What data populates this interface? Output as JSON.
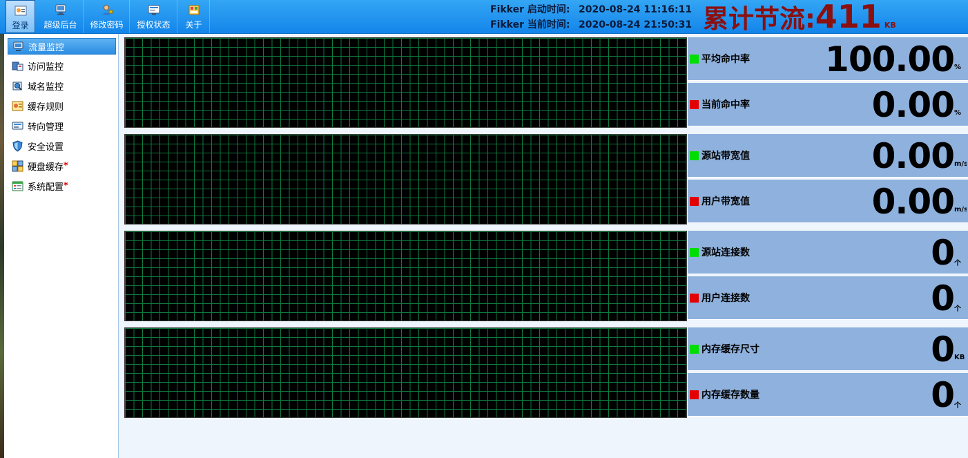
{
  "toolbar": {
    "buttons": [
      {
        "label": "登录",
        "icon": "login-icon"
      },
      {
        "label": "超级后台",
        "icon": "monitor-icon"
      },
      {
        "label": "修改密码",
        "icon": "user-key-icon"
      },
      {
        "label": "授权状态",
        "icon": "license-icon"
      },
      {
        "label": "关于",
        "icon": "about-icon"
      }
    ]
  },
  "times": {
    "start_label": "Fikker 启动时间:",
    "start_value": "2020-08-24 11:16:11",
    "now_label": "Fikker 当前时间:",
    "now_value": "2020-08-24 21:50:31"
  },
  "total": {
    "label": "累计节流:",
    "value": "411",
    "unit": "KB"
  },
  "sidebar": {
    "items": [
      {
        "label": "流量监控",
        "icon": "traffic-monitor-icon"
      },
      {
        "label": "访问监控",
        "icon": "access-monitor-icon"
      },
      {
        "label": "域名监控",
        "icon": "domain-monitor-icon"
      },
      {
        "label": "缓存规则",
        "icon": "cache-rules-icon"
      },
      {
        "label": "转向管理",
        "icon": "redirect-icon"
      },
      {
        "label": "安全设置",
        "icon": "shield-icon"
      },
      {
        "label": "硬盘缓存",
        "icon": "disk-cache-icon",
        "required": "*"
      },
      {
        "label": "系统配置",
        "icon": "system-config-icon",
        "required": "*"
      }
    ]
  },
  "stats": [
    {
      "name": "平均命中率",
      "value": "100.00",
      "unit": "%",
      "color": "green"
    },
    {
      "name": "当前命中率",
      "value": "0.00",
      "unit": "%",
      "color": "red"
    },
    {
      "name": "源站带宽值",
      "value": "0.00",
      "unit": "m/s",
      "color": "green"
    },
    {
      "name": "用户带宽值",
      "value": "0.00",
      "unit": "m/s",
      "color": "red"
    },
    {
      "name": "源站连接数",
      "value": "0",
      "unit": "个",
      "color": "green"
    },
    {
      "name": "用户连接数",
      "value": "0",
      "unit": "个",
      "color": "red"
    },
    {
      "name": "内存缓存尺寸",
      "value": "0",
      "unit": "KB",
      "color": "green"
    },
    {
      "name": "内存缓存数量",
      "value": "0",
      "unit": "个",
      "color": "red"
    }
  ],
  "colors": {
    "toolbar": "#1e90ee",
    "total": "#8b0f0f",
    "stat_panel": "#8fb1dd",
    "graph_bg": "#000000",
    "graph_grid": "#0e7a3e"
  }
}
